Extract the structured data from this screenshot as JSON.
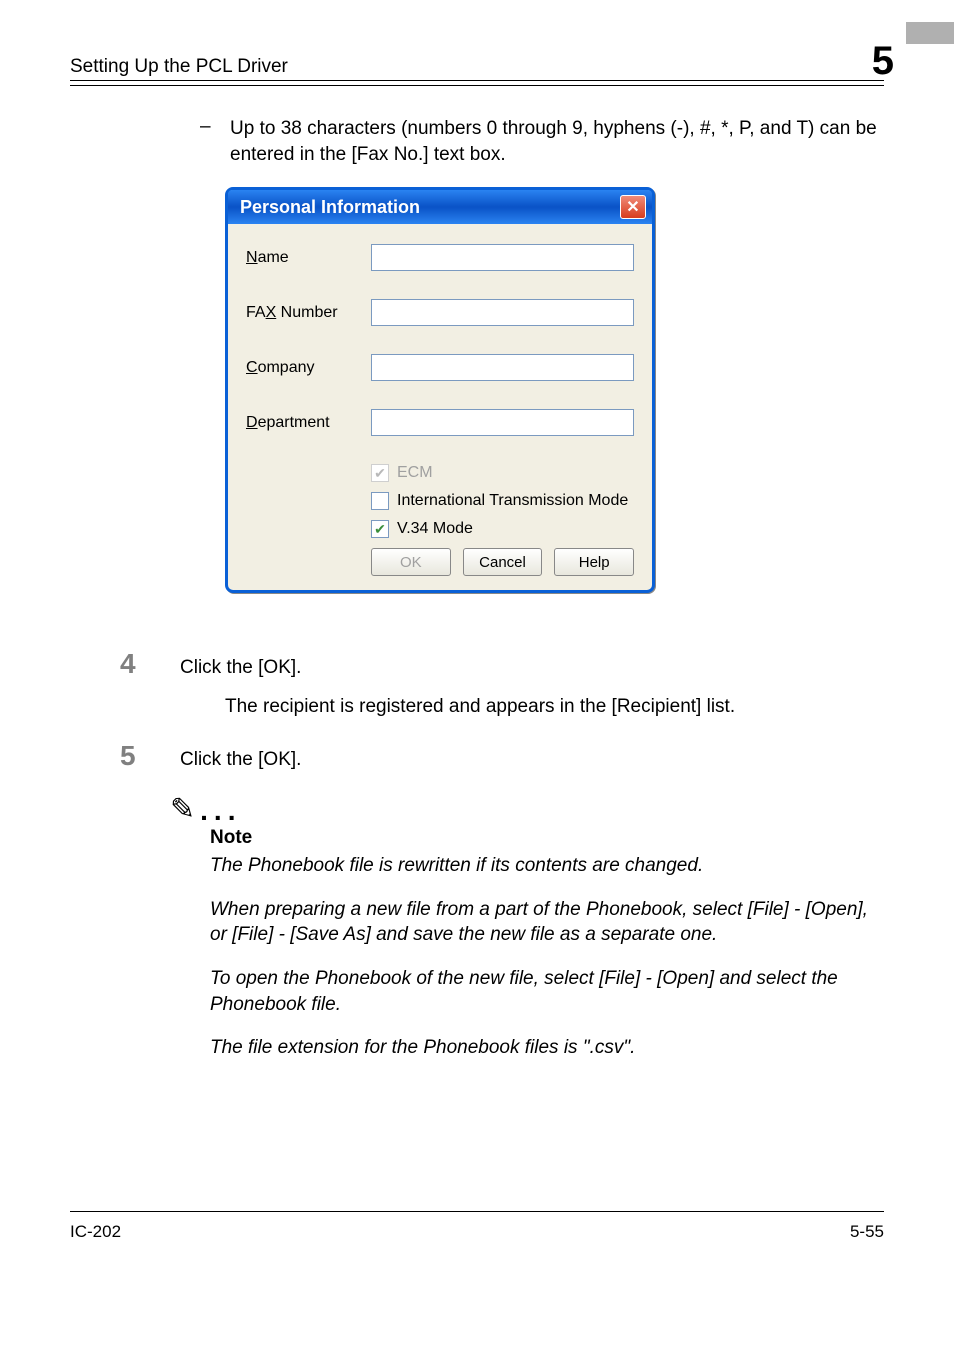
{
  "header": {
    "section_title": "Setting Up the PCL Driver",
    "chapter_number": "5"
  },
  "bullet": {
    "dash": "–",
    "text": "Up to 38 characters (numbers 0 through 9, hyphens (-), #, *, P, and T) can be entered in the [Fax No.] text box."
  },
  "dialog": {
    "title": "Personal Information",
    "close_glyph": "✕",
    "fields": {
      "name": {
        "prefix": "N",
        "rest": "ame",
        "value": ""
      },
      "fax": {
        "prefix": "FA",
        "under": "X",
        "rest": " Number",
        "value": ""
      },
      "company": {
        "under": "C",
        "rest": "ompany",
        "value": ""
      },
      "department": {
        "under": "D",
        "rest": "epartment",
        "value": ""
      }
    },
    "options": {
      "ecm": {
        "under": "E",
        "rest": "CM"
      },
      "intl": {
        "under": "I",
        "rest": "nternational Transmission Mode"
      },
      "v34": {
        "under": "V",
        "rest": ".34 Mode"
      }
    },
    "buttons": {
      "ok": "OK",
      "cancel": "Cancel",
      "help": "Help"
    }
  },
  "steps": {
    "s4_num": "4",
    "s4_text": "Click the [OK].",
    "s4_sub": "The recipient is registered and appears in the [Recipient] list.",
    "s5_num": "5",
    "s5_text": "Click the [OK]."
  },
  "note": {
    "icon": "✎",
    "dots": "...",
    "heading": "Note",
    "p1": "The Phonebook file is rewritten if its contents are changed.",
    "p2": "When preparing a new file from a part of the Phonebook, select [File] - [Open], or [File] - [Save As] and save the new file as a separate one.",
    "p3": "To open the Phonebook of the new file, select [File] - [Open] and select the Phonebook file.",
    "p4": "The file extension for the Phonebook files is \".csv\"."
  },
  "footer": {
    "left": "IC-202",
    "right": "5-55"
  }
}
